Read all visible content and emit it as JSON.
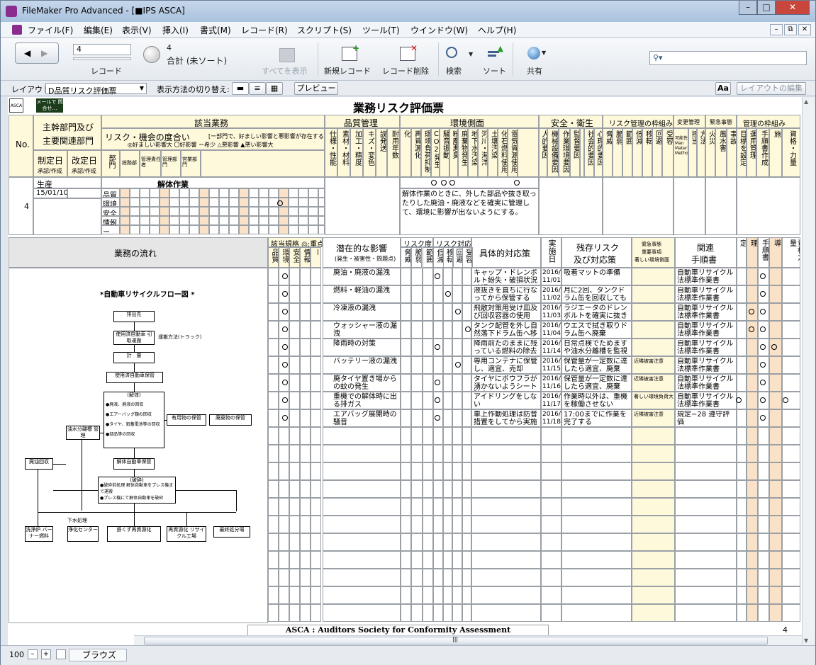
{
  "window": {
    "title": "FileMaker Pro Advanced - [■IPS ASCA]"
  },
  "menu": [
    "ファイル(F)",
    "編集(E)",
    "表示(V)",
    "挿入(I)",
    "書式(M)",
    "レコード(R)",
    "スクリプト(S)",
    "ツール(T)",
    "ウインドウ(W)",
    "ヘルプ(H)"
  ],
  "toolbar": {
    "record_number": "4",
    "records_label": "レコード",
    "found_count": "4",
    "total_label": "合計 (未ソート)",
    "show_all": "すべてを表示",
    "new_record": "新規レコード",
    "delete_record": "レコード削除",
    "find": "検索",
    "sort": "ソート",
    "share": "共有"
  },
  "layoutbar": {
    "layout_label": "レイアウト:",
    "layout_name": "D品質リスク評価票",
    "view_as_label": "表示方法の切り替え:",
    "preview": "プレビュー",
    "aa": "Aa",
    "edit_layout": "レイアウトの編集"
  },
  "form": {
    "logo": "ASCA",
    "mail_button": "メールで 問合せ…",
    "title": "業務リスク評価票",
    "no_label": "No.",
    "main_dept_1": "主幹部門及び",
    "main_dept_2": "主要関連部門",
    "enacted_date": "制定日",
    "revised_date": "改定日",
    "date_sub": "承認/作成",
    "target_work": "該当業務",
    "risk_degree": "リスク・機会の度合い",
    "risk_degree_note": "[ー部門で、好ましい影響と悪影響が存在する]",
    "risk_degree_legend": "◎好ましい影響大 〇好影響 ー希少 △悪影響 ▲悪い影響大",
    "dept": "部門",
    "dept_cols": [
      "総務部",
      "管理責任者",
      "管理部門",
      "営業部門"
    ],
    "quality": "品質管理",
    "environment": "環境側面",
    "safety": "安全・衛生",
    "risk_framework": "リスク管理の枠組み",
    "change_mgmt": "変更管理",
    "emergency": "緊急事態",
    "mgmt_framework": "管理の枠組み",
    "upper_vertical": [
      "仕様・性能",
      "素材・材料",
      "加工・精度",
      "キズ・変色",
      "誤発送",
      "耐用年数",
      "省力化・効率化",
      "再資源化",
      "環境負荷抑制",
      "CO2発生",
      "騒音振動",
      "粉塵悪臭",
      "廃棄物発生",
      "地下水汚染",
      "河川・海洋",
      "土壌汚染",
      "化石燃料使用",
      "電気資源使用",
      "人的要因",
      "機械設備要因",
      "作業環境要因",
      "監督要因",
      "社会的要因",
      "心理的要因",
      "脅威",
      "脆弱",
      "範囲",
      "低減",
      "移転",
      "回避",
      "受容",
      "可能性 Man Material Method",
      "担当",
      "方法",
      "火災",
      "風水害",
      "事故",
      "目標を設定",
      "運用管理",
      "手順書作成",
      "教育・指導実施",
      "資格・力量"
    ],
    "categories": [
      "品質",
      "環境",
      "安全",
      "情報",
      "ー"
    ],
    "work_flow": "業務の流れ",
    "applicable_spec": "該当規格 ◎:重点",
    "lower_spec": [
      "品質",
      "環境",
      "安全",
      "情報",
      "ー"
    ],
    "potential_impact": "潜在的な影響",
    "potential_impact_sub": "(発生・被害性・問題点)",
    "risk_degree_short": "リスク度",
    "risk_response_short": "リスク対応",
    "lower_risk": [
      "脅威",
      "脆弱",
      "範囲",
      "低減",
      "移転",
      "回避",
      "受容"
    ],
    "concrete_measures": "具体的対応策",
    "impl_date": "実施日",
    "residual_risk_1": "残存リスク",
    "residual_risk_2": "及び対応策",
    "emg_1": "緊急事態",
    "emg_2": "重要事項",
    "emg_3": "著しい環境側面",
    "related_1": "関連",
    "related_2": "手順書",
    "lower_right": [
      "目標設定",
      "運用管理",
      "手順書",
      "教育指導",
      "資格力量"
    ],
    "footer": "ASCA : Auditors Society for Conformity Assessment"
  },
  "record": {
    "no": "4",
    "main_dept": "生産",
    "enacted_date": "15/01/10",
    "work_name": "解体作業",
    "env_note": "解体作業のときに、外した部品や抜き取ったりした廃油・廃液などを確実に管理して、環境に影響が出ないようにする。"
  },
  "flow": {
    "title": "*自動車リサイクルフロー図 *",
    "boxes": [
      "排出先",
      "使用済自動車 引取運搬",
      "運搬方法(トラック)",
      "計　量",
      "使用済自動車保管",
      "(解体)",
      "●廃液、廃液の回収",
      "●エアーバッグ類の回収",
      "●タイヤ、鉛蓄電池等の回収",
      "●部品等の回収",
      "油水分離槽 管理",
      "有用物の保管",
      "廃棄物の保管",
      "解体自動車保管",
      "(破砕)",
      "●破砕前処理 解体自動車をプレス機まで運搬",
      "●プレス機にて解体自動車を破砕",
      "廃油回収",
      "下水処理",
      "洗浄炉 バーナー燃料",
      "浄化センター",
      "鉄くず再資源化",
      "再資源化 リサイクル工場",
      "最終処分場"
    ]
  },
  "items": [
    {
      "impact": "廃油・廃液の漏洩",
      "measure": "キャップ・ドレンボルト紛失・破損状況確認",
      "date": "2016/ 11/01",
      "residual": "吸着マットの準備",
      "emg": "",
      "related": "自動車リサイクル法標準作業書"
    },
    {
      "impact": "燃料・軽油の漏洩",
      "measure": "液抜きを直ちに行なってから保管する",
      "date": "2016/ 11/02",
      "residual": "月に2回、タンクドラム缶を回収してもらう",
      "emg": "",
      "related": "自動車リサイクル法標準作業書"
    },
    {
      "impact": "冷凍液の漏洩",
      "measure": "飛散対策用受け皿及び回収容器の使用",
      "date": "2016/ 11/03",
      "residual": "ラジエータのドレンボルトを確実に抜き外す",
      "emg": "",
      "related": "自動車リサイクル法標準作業書"
    },
    {
      "impact": "ウォッシャー液の漏洩",
      "measure": "タンク配管を外し自然落下ドラム缶へ移す",
      "date": "2016/ 11/04",
      "residual": "ウエスで拭き取りドラム缶へ廃棄",
      "emg": "",
      "related": "自動車リサイクル法標準作業書"
    },
    {
      "impact": "降雨時の対策",
      "measure": "降雨前たのままに残っている燃料の除去",
      "date": "2016/ 11/14",
      "residual": "日常点検でためますや油水分離槽を監視",
      "emg": "",
      "related": "自動車リサイクル法標準作業書"
    },
    {
      "impact": "バッテリー液の漏洩",
      "measure": "専用コンテナに保管し、適宜、売却",
      "date": "2016/ 11/15",
      "residual": "保管量が一定数に達したら適宜、廃棄",
      "emg": "近隣被害注意",
      "related": "自動車リサイクル法標準作業書"
    },
    {
      "impact": "廃タイヤ置き場からの蚊の発生",
      "measure": "タイヤにボウフラが湧かないようシート防水",
      "date": "2016/ 11/16",
      "residual": "保管量が一定数に達したら適宜、廃棄",
      "emg": "近隣被害注意",
      "related": "自動車リサイクル法標準作業書"
    },
    {
      "impact": "重機での解体時に出る排ガス",
      "measure": "アイドリングをしない",
      "date": "2016/ 11/17",
      "residual": "作業時以外は、重機を稼働させない",
      "emg": "著しい環境負荷大",
      "related": "自動車リサイクル法標準作業書"
    },
    {
      "impact": "エアバッグ展開時の騒音",
      "measure": "車上作動処理は防音措置をしてから実施",
      "date": "2016/ 11/18",
      "residual": "17:00までに作業を完了する",
      "emg": "近隣被害注意",
      "related": "規定−28 遵守評価"
    }
  ],
  "statusbar": {
    "zoom": "100",
    "mode": "ブラウズ"
  }
}
